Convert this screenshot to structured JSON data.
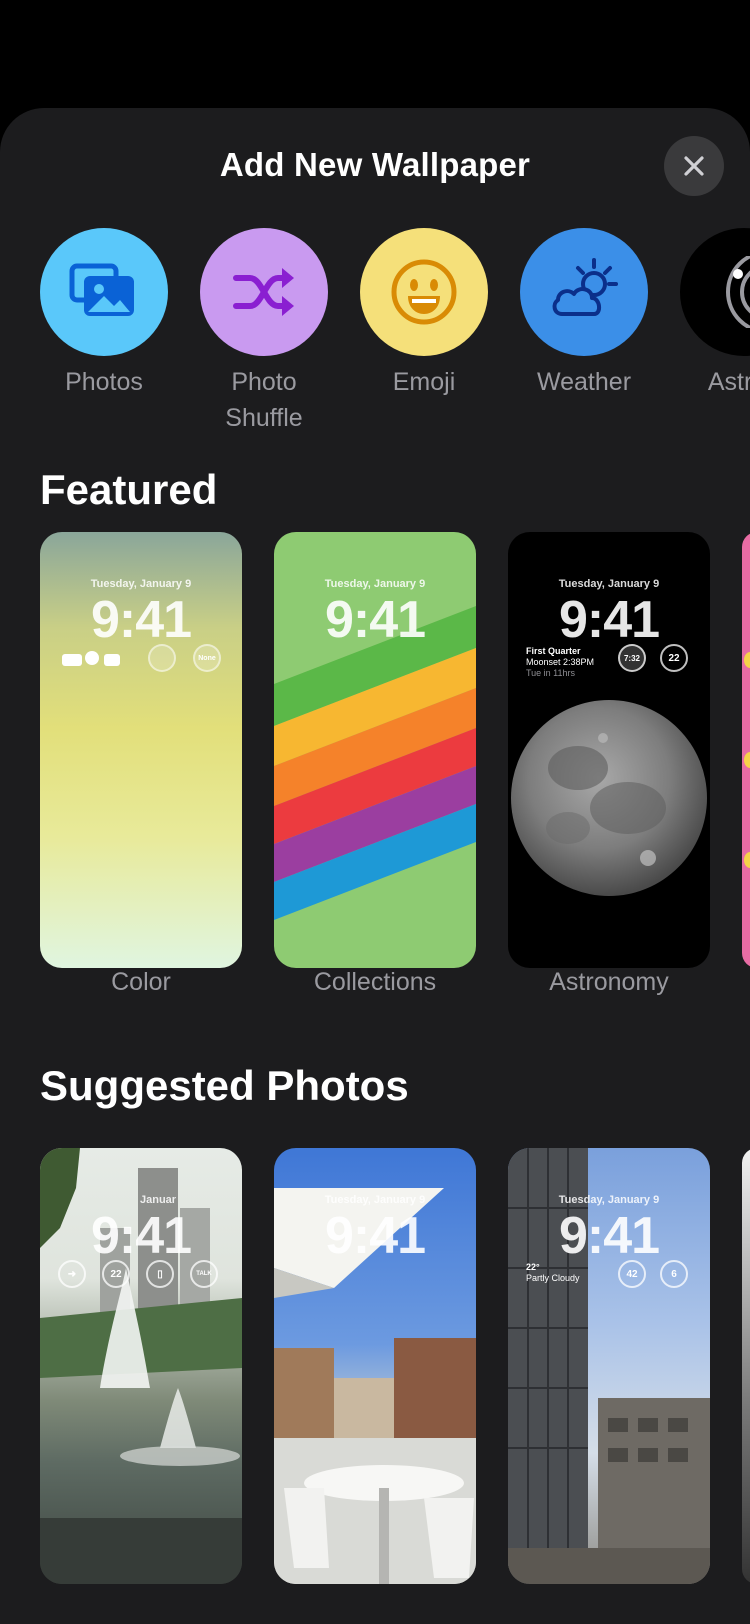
{
  "header": {
    "title": "Add New Wallpaper"
  },
  "types": [
    {
      "label": "Photos",
      "color": "#5ac8fa",
      "icon": "photos-icon"
    },
    {
      "label": "Photo",
      "label2": "Shuffle",
      "color": "#c99af0",
      "icon": "shuffle-icon"
    },
    {
      "label": "Emoji",
      "color": "#f5e07a",
      "icon": "emoji-icon"
    },
    {
      "label": "Weather",
      "color": "#3b8fe8",
      "icon": "weather-icon"
    },
    {
      "label": "Astron",
      "color": "#000000",
      "icon": "astronomy-icon"
    }
  ],
  "featured": {
    "title": "Featured",
    "cards": [
      {
        "label": "Color",
        "date": "Tuesday, January 9",
        "time": "9:41",
        "widget": "None"
      },
      {
        "label": "Collections",
        "date": "Tuesday, January 9",
        "time": "9:41"
      },
      {
        "label": "Astronomy",
        "date": "Tuesday, January 9",
        "time": "9:41",
        "moon_phase": "First Quarter",
        "moonset": "Moonset 2:38PM",
        "moonset_sub": "Tue in 11hrs",
        "time_widget": "7:32",
        "time_widget_sub": "PM",
        "gauge": "22"
      }
    ]
  },
  "suggested": {
    "title": "Suggested Photos",
    "cards": [
      {
        "date": "Januar",
        "time": "9:41",
        "gauge": "22",
        "talk": "TALK"
      },
      {
        "date": "Tuesday, January 9",
        "time": "9:41"
      },
      {
        "date": "Tuesday, January 9",
        "time": "9:41",
        "temp": "22°",
        "condition": "Partly Cloudy",
        "gauge1": "42",
        "gauge2": "6"
      }
    ]
  }
}
